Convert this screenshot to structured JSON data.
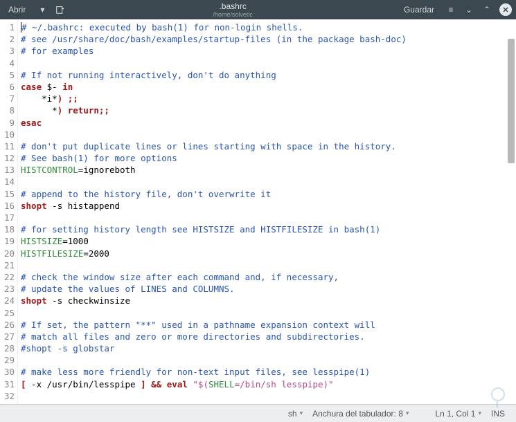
{
  "titlebar": {
    "open_label": "Abrir",
    "filename": ".bashrc",
    "path": "/home/solvetic",
    "save_label": "Guardar"
  },
  "code": {
    "lines": [
      {
        "n": 1,
        "segs": [
          [
            "cursor",
            ""
          ],
          [
            "comment",
            "# ~/.bashrc: executed by bash(1) for non-login shells."
          ]
        ]
      },
      {
        "n": 2,
        "segs": [
          [
            "comment",
            "# see /usr/share/doc/bash/examples/startup-files (in the package bash-doc)"
          ]
        ]
      },
      {
        "n": 3,
        "segs": [
          [
            "comment",
            "# for examples"
          ]
        ]
      },
      {
        "n": 4,
        "segs": []
      },
      {
        "n": 5,
        "segs": [
          [
            "comment",
            "# If not running interactively, don't do anything"
          ]
        ]
      },
      {
        "n": 6,
        "segs": [
          [
            "keyword",
            "case"
          ],
          [
            "plain",
            " $- "
          ],
          [
            "keyword",
            "in"
          ]
        ]
      },
      {
        "n": 7,
        "segs": [
          [
            "plain",
            "    *i*"
          ],
          [
            "keyword",
            ")"
          ],
          [
            "plain",
            " "
          ],
          [
            "keyword",
            ";;"
          ]
        ]
      },
      {
        "n": 8,
        "segs": [
          [
            "plain",
            "      *"
          ],
          [
            "keyword",
            ")"
          ],
          [
            "plain",
            " "
          ],
          [
            "keyword",
            "return"
          ],
          [
            "keyword",
            ";;"
          ]
        ]
      },
      {
        "n": 9,
        "segs": [
          [
            "keyword",
            "esac"
          ]
        ]
      },
      {
        "n": 10,
        "segs": []
      },
      {
        "n": 11,
        "segs": [
          [
            "comment",
            "# don't put duplicate lines or lines starting with space in the history."
          ]
        ]
      },
      {
        "n": 12,
        "segs": [
          [
            "comment",
            "# See bash(1) for more options"
          ]
        ]
      },
      {
        "n": 13,
        "segs": [
          [
            "var",
            "HISTCONTROL"
          ],
          [
            "plain",
            "=ignoreboth"
          ]
        ]
      },
      {
        "n": 14,
        "segs": []
      },
      {
        "n": 15,
        "segs": [
          [
            "comment",
            "# append to the history file, don't overwrite it"
          ]
        ]
      },
      {
        "n": 16,
        "segs": [
          [
            "keyword",
            "shopt"
          ],
          [
            "plain",
            " -s histappend"
          ]
        ]
      },
      {
        "n": 17,
        "segs": []
      },
      {
        "n": 18,
        "segs": [
          [
            "comment",
            "# for setting history length see HISTSIZE and HISTFILESIZE in bash(1)"
          ]
        ]
      },
      {
        "n": 19,
        "segs": [
          [
            "var",
            "HISTSIZE"
          ],
          [
            "plain",
            "=1000"
          ]
        ]
      },
      {
        "n": 20,
        "segs": [
          [
            "var",
            "HISTFILESIZE"
          ],
          [
            "plain",
            "=2000"
          ]
        ]
      },
      {
        "n": 21,
        "segs": []
      },
      {
        "n": 22,
        "segs": [
          [
            "comment",
            "# check the window size after each command and, if necessary,"
          ]
        ]
      },
      {
        "n": 23,
        "segs": [
          [
            "comment",
            "# update the values of LINES and COLUMNS."
          ]
        ]
      },
      {
        "n": 24,
        "segs": [
          [
            "keyword",
            "shopt"
          ],
          [
            "plain",
            " -s checkwinsize"
          ]
        ]
      },
      {
        "n": 25,
        "segs": []
      },
      {
        "n": 26,
        "segs": [
          [
            "comment",
            "# If set, the pattern \"**\" used in a pathname expansion context will"
          ]
        ]
      },
      {
        "n": 27,
        "segs": [
          [
            "comment",
            "# match all files and zero or more directories and subdirectories."
          ]
        ]
      },
      {
        "n": 28,
        "segs": [
          [
            "comment",
            "#shopt -s globstar"
          ]
        ]
      },
      {
        "n": 29,
        "segs": []
      },
      {
        "n": 30,
        "segs": [
          [
            "comment",
            "# make less more friendly for non-text input files, see lesspipe(1)"
          ]
        ]
      },
      {
        "n": 31,
        "segs": [
          [
            "keyword",
            "["
          ],
          [
            "plain",
            " -x /usr/bin/lesspipe "
          ],
          [
            "keyword",
            "]"
          ],
          [
            "plain",
            " "
          ],
          [
            "op",
            "&&"
          ],
          [
            "plain",
            " "
          ],
          [
            "keyword",
            "eval"
          ],
          [
            "plain",
            " "
          ],
          [
            "string",
            "\"$("
          ],
          [
            "var",
            "SHELL"
          ],
          [
            "string",
            "=/bin/sh lesspipe)\""
          ]
        ]
      },
      {
        "n": 32,
        "segs": []
      }
    ]
  },
  "statusbar": {
    "language": "sh",
    "tab_label": "Anchura del tabulador: 8",
    "position": "Ln 1, Col 1",
    "ins_mode": "INS"
  }
}
